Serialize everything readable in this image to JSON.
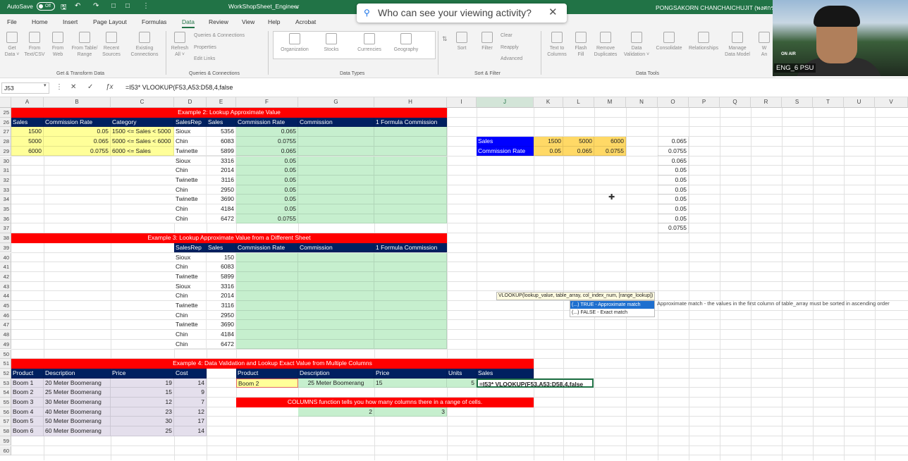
{
  "app": {
    "autosave": "AutoSave",
    "toggle": "Off",
    "filename": "WorkShopSheet_Engineer",
    "user": "PONGSAKORN CHANCHAICHUJIT (พงศกร ชาญ"
  },
  "notice": {
    "text": "Who can see your viewing activity?"
  },
  "menu": [
    "File",
    "Home",
    "Insert",
    "Page Layout",
    "Formulas",
    "Data",
    "Review",
    "View",
    "Help",
    "Acrobat"
  ],
  "ribbon": {
    "get_data": "Get",
    "get_data2": "Data ˅",
    "from_text": "From",
    "from_text2": "Text/CSV",
    "from_web": "From",
    "from_web2": "Web",
    "from_table": "From Table/",
    "from_table2": "Range",
    "recent": "Recent",
    "recent2": "Sources",
    "existing": "Existing",
    "existing2": "Connections",
    "refresh": "Refresh",
    "refresh2": "All ˅",
    "queries_conn": "Queries & Connections",
    "properties": "Properties",
    "edit_links": "Edit Links",
    "organization": "Organization",
    "stocks": "Stocks",
    "currencies": "Currencies",
    "geography": "Geography",
    "sort": "Sort",
    "filter": "Filter",
    "clear": "Clear",
    "reapply": "Reapply",
    "advanced": "Advanced",
    "text_cols": "Text to",
    "text_cols2": "Columns",
    "flash": "Flash",
    "flash2": "Fill",
    "remove": "Remove",
    "remove2": "Duplicates",
    "validation": "Data",
    "validation2": "Validation ˅",
    "consolidate": "Consolidate",
    "relationships": "Relationships",
    "manage": "Manage",
    "manage2": "Data Model",
    "wa": "W",
    "an": "An",
    "groups": {
      "get": "Get & Transform Data",
      "queries": "Queries & Connections",
      "types": "Data Types",
      "sort": "Sort & Filter",
      "tools": "Data Tools"
    }
  },
  "video": {
    "onair": "ON AIR",
    "label": "ENG_6 PSU"
  },
  "formula_bar": {
    "cell": "J53",
    "formula": "=I53* VLOOKUP(F53,A53:D58,4,false"
  },
  "columns": [
    "A",
    "B",
    "C",
    "D",
    "E",
    "F",
    "G",
    "H",
    "I",
    "J",
    "K",
    "L",
    "M",
    "N",
    "O",
    "P",
    "Q",
    "R",
    "S",
    "T",
    "U",
    "V"
  ],
  "rows": [
    "25",
    "26",
    "27",
    "28",
    "29",
    "30",
    "31",
    "32",
    "33",
    "34",
    "35",
    "36",
    "37",
    "38",
    "39",
    "40",
    "41",
    "42",
    "43",
    "44",
    "45",
    "46",
    "47",
    "48",
    "49",
    "50",
    "51",
    "52",
    "53",
    "54",
    "55",
    "56",
    "57",
    "58",
    "59",
    "60"
  ],
  "ex2": {
    "title": "Example 2: Lookup Approximate Value",
    "hdr": [
      "Sales",
      "Commission Rate",
      "Category",
      "SalesRep",
      "Sales",
      "Commission Rate",
      "Commission",
      "1 Formula Commission"
    ],
    "table": [
      [
        "1500",
        "0.05",
        "1500 <= Sales < 5000"
      ],
      [
        "5000",
        "0.065",
        "5000 <= Sales < 6000"
      ],
      [
        "6000",
        "0.0755",
        "6000 <= Sales"
      ]
    ],
    "reps": [
      "Sioux",
      "Chin",
      "Twinette",
      "Sioux",
      "Chin",
      "Twinette",
      "Chin",
      "Twinette",
      "Chin",
      "Chin"
    ],
    "sales": [
      "5356",
      "6083",
      "5899",
      "3316",
      "2014",
      "3116",
      "2950",
      "3690",
      "4184",
      "6472"
    ],
    "rates": [
      "0.065",
      "0.0755",
      "0.065",
      "0.05",
      "0.05",
      "0.05",
      "0.05",
      "0.05",
      "0.05",
      "0.0755"
    ]
  },
  "side": {
    "sales_label": "Sales",
    "rate_label": "Commission Rate",
    "sales": [
      "1500",
      "5000",
      "6000"
    ],
    "rates": [
      "0.05",
      "0.065",
      "0.0755"
    ],
    "ocol": [
      "0.065",
      "0.0755",
      "0.065",
      "0.05",
      "0.05",
      "0.05",
      "0.05",
      "0.05",
      "0.05",
      "0.0755"
    ]
  },
  "ex3": {
    "title": "Example 3: Lookup Approximate Value from a Different Sheet",
    "hdr": [
      "SalesRep",
      "Sales",
      "Commission Rate",
      "Commission",
      "1 Formula Commission"
    ],
    "reps": [
      "Sioux",
      "Chin",
      "Twinette",
      "Sioux",
      "Chin",
      "Twinette",
      "Chin",
      "Twinette",
      "Chin",
      "Chin"
    ],
    "sales": [
      "150",
      "6083",
      "5899",
      "3316",
      "2014",
      "3116",
      "2950",
      "3690",
      "4184",
      "6472"
    ]
  },
  "ex4": {
    "title": "Example 4: Data Validation and Lookup Exact Value from Multiple Columns",
    "hdr": [
      "Product",
      "Description",
      "Price",
      "Cost"
    ],
    "rows": [
      [
        "Boom 1",
        "20 Meter Boomerang",
        "19",
        "14"
      ],
      [
        "Boom 2",
        "25 Meter Boomerang",
        "15",
        "9"
      ],
      [
        "Boom 3",
        "30 Meter Boomerang",
        "12",
        "7"
      ],
      [
        "Boom 4",
        "40 Meter Boomerang",
        "23",
        "12"
      ],
      [
        "Boom 5",
        "50 Meter Boomerang",
        "30",
        "17"
      ],
      [
        "Boom 6",
        "60 Meter Boomerang",
        "25",
        "14"
      ]
    ],
    "hdr2": [
      "Product",
      "Description",
      "Price",
      "Units",
      "Sales"
    ],
    "row2": [
      "Boom 2",
      "25 Meter Boomerang",
      "15",
      "5",
      "=I53* VLOOKUP(F53,A53:D58,4,false"
    ],
    "note": "COLUMNS function tells you how many columns there in a range of cells.",
    "col_vals": [
      "2",
      "3"
    ]
  },
  "tooltip": {
    "sig": "VLOOKUP(lookup_value, table_array, col_index_num, [range_lookup])",
    "opt1": "(...) TRUE - Approximate match",
    "opt2": "(...) FALSE - Exact match",
    "desc": "Approximate match - the values in the first column of table_array must be sorted in ascending order"
  },
  "colors": {
    "excel_green": "#217346",
    "red": "#ff0000",
    "navy": "#002060",
    "yellow": "#ffff99",
    "green": "#c6efce",
    "blue": "#0000ff",
    "lavender": "#e4dfec"
  }
}
